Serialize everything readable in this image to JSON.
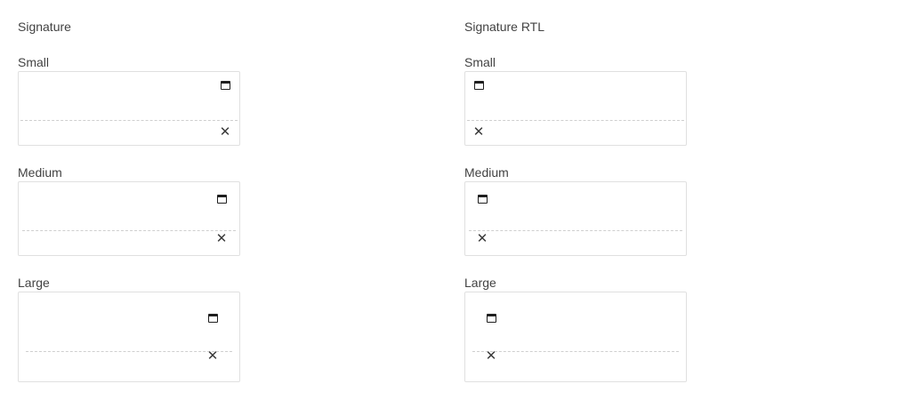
{
  "ltr": {
    "title": "Signature",
    "sizes": [
      {
        "label": "Small"
      },
      {
        "label": "Medium"
      },
      {
        "label": "Large"
      }
    ]
  },
  "rtl": {
    "title": "Signature RTL",
    "sizes": [
      {
        "label": "Small"
      },
      {
        "label": "Medium"
      },
      {
        "label": "Large"
      }
    ]
  },
  "icons": {
    "maximize": "calendar-like maximize icon",
    "clear": "✕"
  }
}
